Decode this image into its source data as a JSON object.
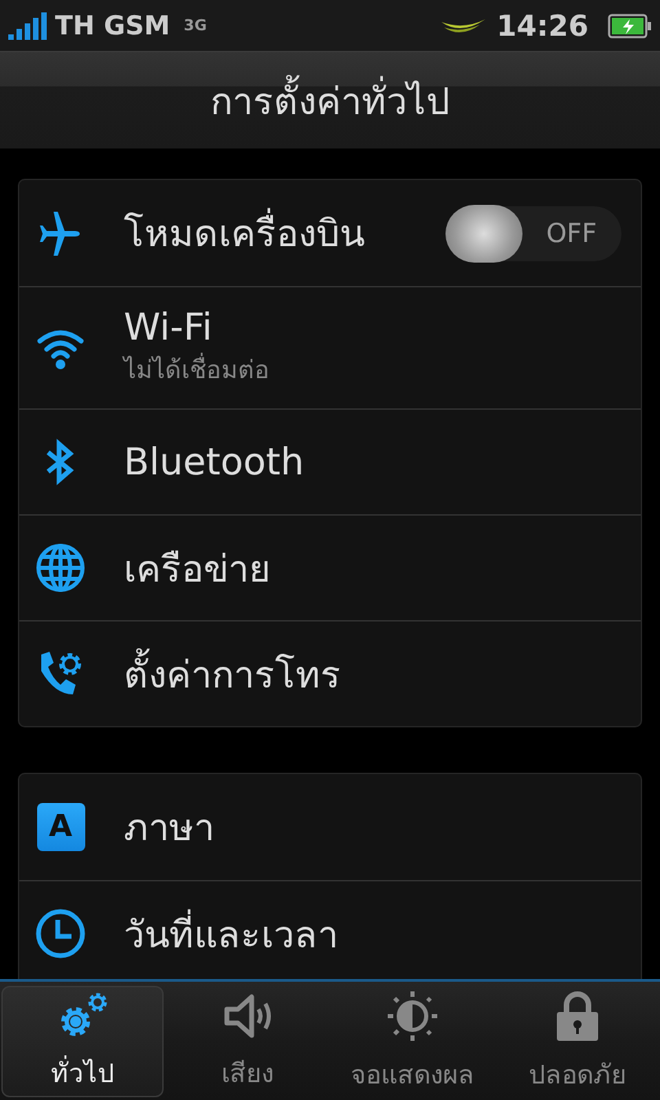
{
  "status_bar": {
    "carrier": "TH GSM",
    "network": "3G",
    "time": "14:26"
  },
  "title": "การตั้งค่าทั่วไป",
  "groups": [
    {
      "items": [
        {
          "label": "โหมดเครื่องบิน",
          "toggle": {
            "on": false,
            "label": "OFF"
          }
        },
        {
          "label": "Wi-Fi",
          "summary": "ไม่ได้เชื่อมต่อ"
        },
        {
          "label": "Bluetooth"
        },
        {
          "label": "เครือข่าย"
        },
        {
          "label": "ตั้งค่าการโทร"
        }
      ]
    },
    {
      "items": [
        {
          "label": "ภาษา",
          "icon_text": "A"
        },
        {
          "label": "วันที่และเวลา"
        }
      ]
    }
  ],
  "tabs": [
    {
      "label": "ทั่วไป",
      "selected": true
    },
    {
      "label": "เสียง",
      "selected": false
    },
    {
      "label": "จอแสดงผล",
      "selected": false
    },
    {
      "label": "ปลอดภัย",
      "selected": false
    }
  ]
}
